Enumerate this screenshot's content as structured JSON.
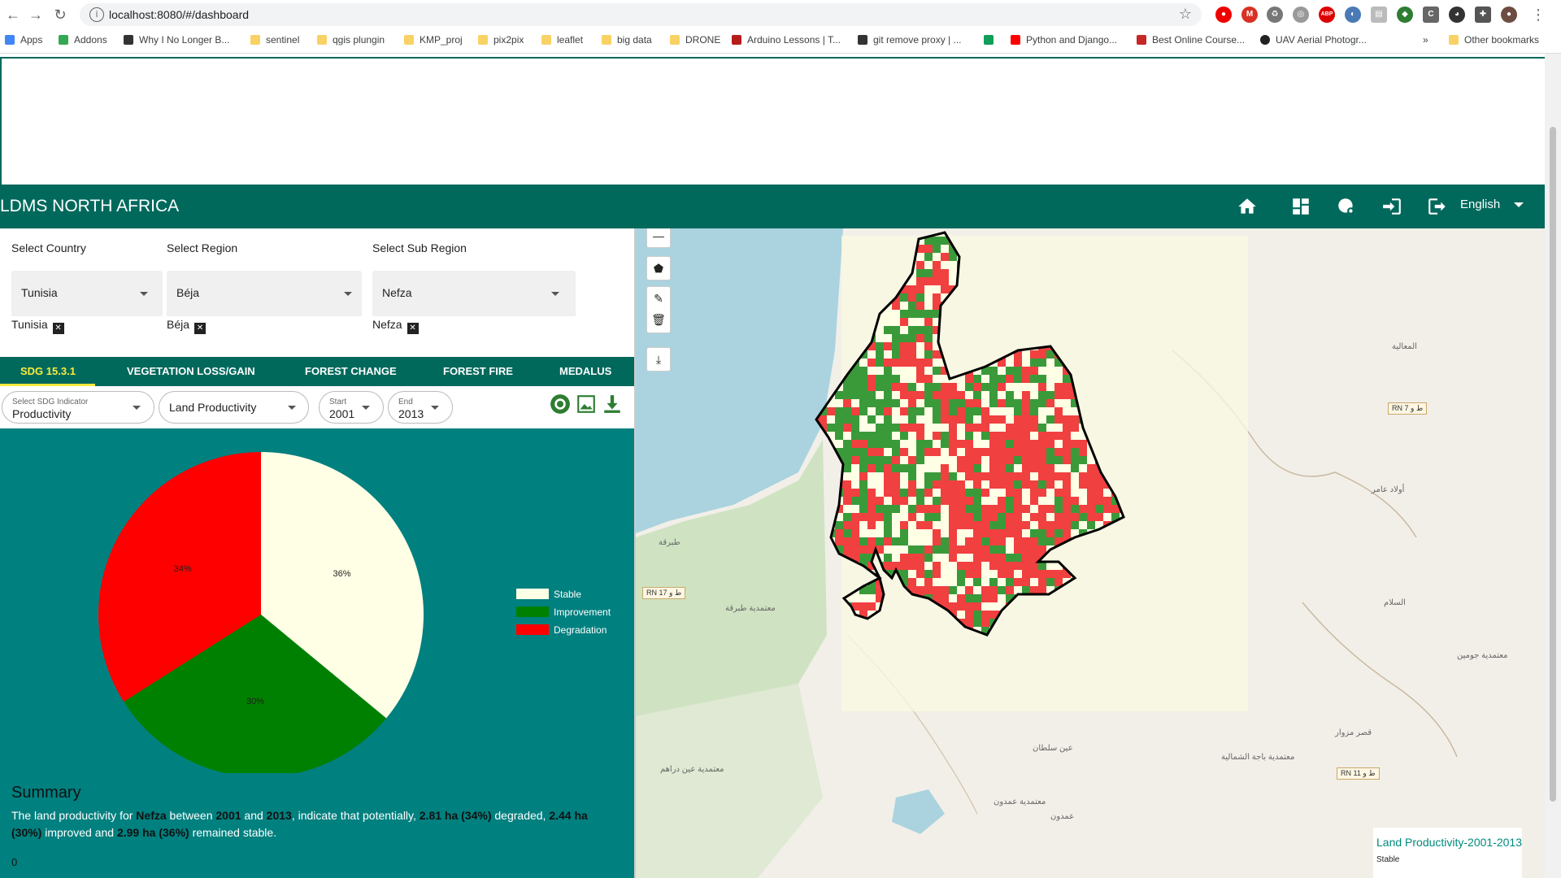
{
  "browser": {
    "url": "localhost:8080/#/dashboard",
    "bookmarks": [
      "Apps",
      "Addons",
      "Why I No Longer B...",
      "sentinel",
      "qgis plungin",
      "KMP_proj",
      "pix2pix",
      "leaflet",
      "big data",
      "DRONE",
      "Arduino Lessons | T...",
      "git remove proxy | ...",
      "Python and Django...",
      "Best Online Course...",
      "UAV Aerial Photogr...",
      "»",
      "Other bookmarks"
    ]
  },
  "header": {
    "title": "LDMS NORTH AFRICA",
    "language": "English"
  },
  "selectors": {
    "country": {
      "label": "Select Country",
      "value": "Tunisia",
      "chip": "Tunisia"
    },
    "region": {
      "label": "Select Region",
      "value": "Béja",
      "chip": "Béja"
    },
    "subregion": {
      "label": "Select Sub Region",
      "value": "Nefza",
      "chip": "Nefza"
    }
  },
  "tabs": [
    "SDG 15.3.1",
    "VEGETATION LOSS/GAIN",
    "FOREST CHANGE",
    "FOREST FIRE",
    "MEDALUS"
  ],
  "filters": {
    "indicator": {
      "label": "Select SDG Indicator",
      "value": "Productivity"
    },
    "dataset": {
      "value": "Land Productivity"
    },
    "start": {
      "label": "Start",
      "value": "2001"
    },
    "end": {
      "label": "End",
      "value": "2013"
    }
  },
  "chart_data": {
    "type": "pie",
    "labels": [
      "Stable",
      "Improvement",
      "Degradation"
    ],
    "values": [
      36,
      30,
      34
    ],
    "value_labels": [
      "36%",
      "30%",
      "34%"
    ],
    "colors": [
      "#ffffe6",
      "#008000",
      "#ff0000"
    ],
    "legend_position": "right"
  },
  "summary": {
    "heading": "Summary",
    "p1": "The land productivity for ",
    "region": "Nefza",
    "p2": " between ",
    "start": "2001",
    "p3": " and ",
    "end": "2013",
    "p4": ", indicate that potentially, ",
    "degraded": "2.81 ha (34%)",
    "p5": " degraded, ",
    "improved": "2.44 ha (30%)",
    "p6": " improved and ",
    "stable": "2.99 ha (36%)",
    "p7": " remained stable.",
    "footer": "0"
  },
  "map": {
    "legend_title": "Land Productivity-2001-2013",
    "legend_item": "Stable",
    "roads": [
      "RN 7 ط و",
      "RN 17 ط و",
      "RN 11 ط و"
    ],
    "places": [
      "طبرقة",
      "معتمدية طبرقة",
      "عين سلطان",
      "معتمدية باجة الشمالية",
      "عمدون",
      "معتمدية عمدون",
      "معتمدية جومين",
      "قصر مزوار",
      "أولاد عامر",
      "السلام",
      "المعالية",
      "معتمدية عين دراهم"
    ]
  }
}
